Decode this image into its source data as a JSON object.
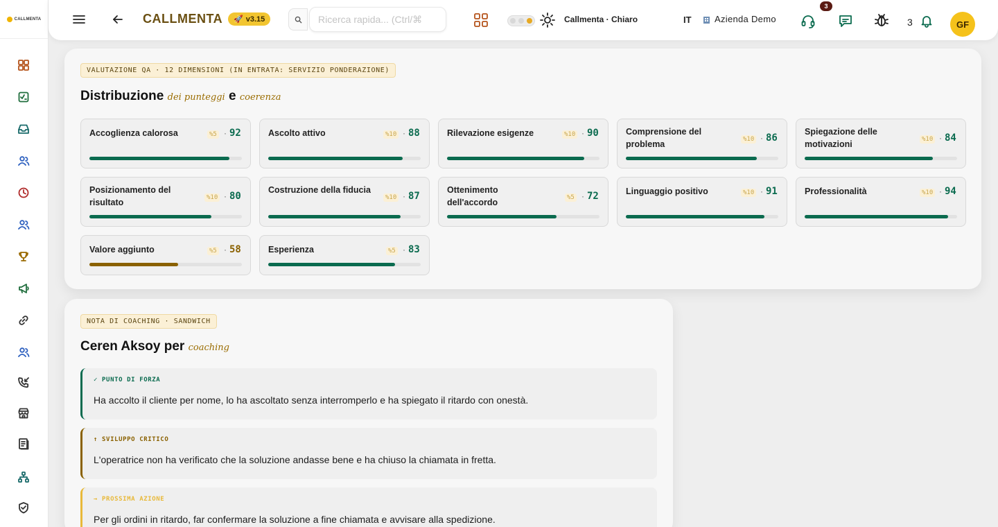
{
  "sidebar": {
    "brand": "CALLMENTA",
    "items": [
      {
        "icon": "dashboard-icon",
        "color": "#b5541c"
      },
      {
        "icon": "scorecard-icon",
        "color": "#1f6d3c"
      },
      {
        "icon": "inbox-icon",
        "color": "#1a6b6b"
      },
      {
        "icon": "users-icon",
        "color": "#2c5fbf"
      },
      {
        "icon": "clock-icon",
        "color": "#b02a2a"
      },
      {
        "icon": "team-icon",
        "color": "#2c5fbf"
      },
      {
        "icon": "trophy-icon",
        "color": "#9a6a00"
      },
      {
        "icon": "megaphone-icon",
        "color": "#1f6d3c"
      },
      {
        "icon": "link-icon",
        "color": "#333333"
      },
      {
        "icon": "group-icon",
        "color": "#2c5fbf"
      },
      {
        "icon": "incoming-call-icon",
        "color": "#333333"
      },
      {
        "icon": "store-icon",
        "color": "#333333"
      },
      {
        "icon": "report-icon",
        "color": "#333333"
      },
      {
        "icon": "org-chart-icon",
        "color": "#1a6b6b"
      },
      {
        "icon": "shield-icon",
        "color": "#333333"
      }
    ]
  },
  "header": {
    "app_title": "CALLMENTA",
    "version": "v3.15",
    "search_placeholder": "Ricerca rapida... (Ctrl/⌘",
    "theme_label": "Callmenta · Chiaro",
    "language": "IT",
    "company": "Azienda Demo",
    "support_badge": "3",
    "notifications_count": "3",
    "avatar_initials": "GF"
  },
  "qa": {
    "tag": "VALUTAZIONE QA · 12 DIMENSIONI (IN ENTRATA: SERVIZIO PONDERAZIONE)",
    "heading_main": "Distribuzione",
    "heading_accent_1": "dei punteggi",
    "heading_and": "e",
    "heading_accent_2": "coerenza",
    "dimensions": [
      {
        "name": "Accoglienza calorosa",
        "weight": "%5",
        "score": 92
      },
      {
        "name": "Ascolto attivo",
        "weight": "%10",
        "score": 88
      },
      {
        "name": "Rilevazione esigenze",
        "weight": "%10",
        "score": 90
      },
      {
        "name": "Comprensione del problema",
        "weight": "%10",
        "score": 86
      },
      {
        "name": "Spiegazione delle motivazioni",
        "weight": "%10",
        "score": 84
      },
      {
        "name": "Posizionamento del risultato",
        "weight": "%10",
        "score": 80
      },
      {
        "name": "Costruzione della fiducia",
        "weight": "%10",
        "score": 87
      },
      {
        "name": "Ottenimento dell'accordo",
        "weight": "%5",
        "score": 72
      },
      {
        "name": "Linguaggio positivo",
        "weight": "%10",
        "score": 91
      },
      {
        "name": "Professionalità",
        "weight": "%10",
        "score": 94
      },
      {
        "name": "Valore aggiunto",
        "weight": "%5",
        "score": 58
      },
      {
        "name": "Esperienza",
        "weight": "%5",
        "score": 83
      }
    ],
    "colors": {
      "good": "#0b6b4f",
      "warn": "#8a6100"
    }
  },
  "coaching": {
    "tag": "NOTA DI COACHING · SANDWICH",
    "heading_main": "Ceren Aksoy per",
    "heading_accent": "coaching",
    "notes": [
      {
        "label": "✓ PUNTO DI FORZA",
        "text": "Ha accolto il cliente per nome, lo ha ascoltato senza interromperlo e ha spiegato il ritardo con onestà.",
        "color": "#0b6b4f"
      },
      {
        "label": "↑ SVILUPPO CRITICO",
        "text": "L'operatrice non ha verificato che la soluzione andasse bene e ha chiuso la chiamata in fretta.",
        "color": "#8a6100"
      },
      {
        "label": "→ PROSSIMA AZIONE",
        "text": "Per gli ordini in ritardo, far confermare la soluzione a fine chiamata e avvisare alla spedizione.",
        "color": "#e8b93a"
      }
    ]
  }
}
